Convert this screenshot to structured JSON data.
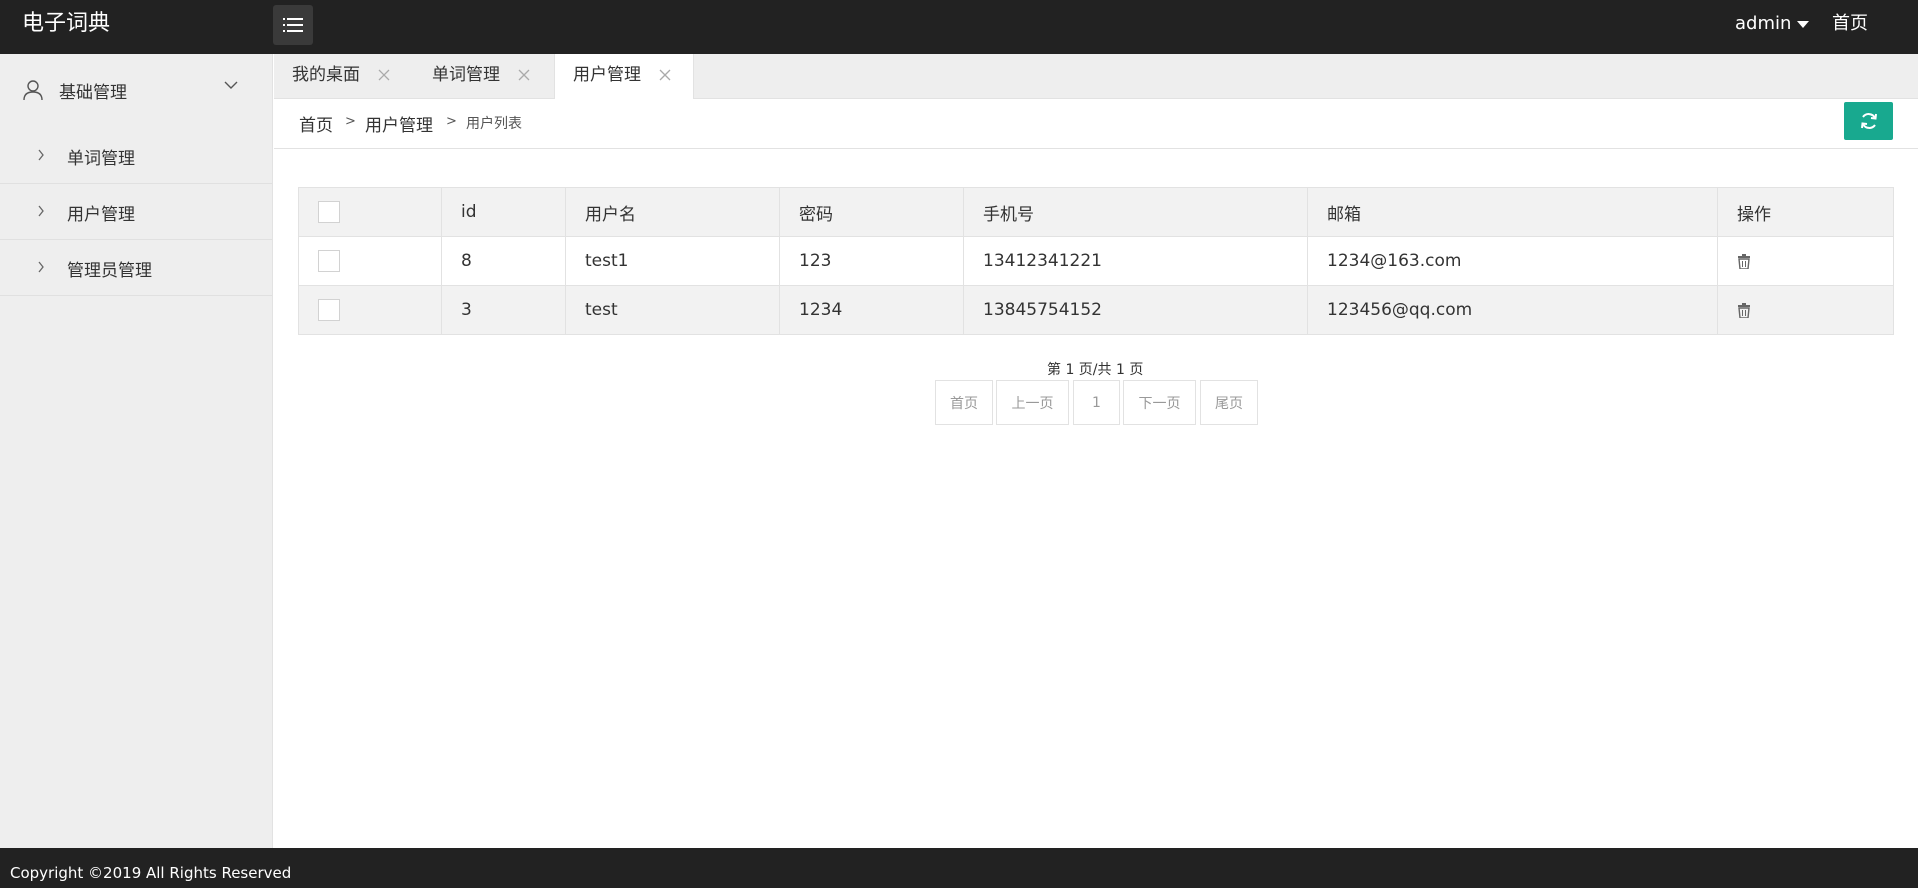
{
  "app": {
    "title": "电子词典"
  },
  "header": {
    "user": "admin",
    "home": "首页",
    "menu_icon": "menu-icon"
  },
  "sidebar": {
    "group": {
      "label": "基础管理",
      "icon": "user-icon"
    },
    "items": [
      {
        "label": "单词管理"
      },
      {
        "label": "用户管理"
      },
      {
        "label": "管理员管理"
      }
    ]
  },
  "tabs": [
    {
      "label": "我的桌面"
    },
    {
      "label": "单词管理"
    },
    {
      "label": "用户管理",
      "active": true
    }
  ],
  "breadcrumb": {
    "home": "首页",
    "sep": ">",
    "section": "用户管理",
    "current": "用户列表"
  },
  "table": {
    "columns": [
      "",
      "id",
      "用户名",
      "密码",
      "手机号",
      "邮箱",
      "操作"
    ],
    "rows": [
      {
        "id": "8",
        "username": "test1",
        "password": "123",
        "phone": "13412341221",
        "email": "1234@163.com"
      },
      {
        "id": "3",
        "username": "test",
        "password": "1234",
        "phone": "13845754152",
        "email": "123456@qq.com"
      }
    ]
  },
  "pagination": {
    "info": "第 1 页/共 1 页",
    "first": "首页",
    "prev": "上一页",
    "page": "1",
    "next": "下一页",
    "last": "尾页"
  },
  "footer": {
    "copyright": "Copyright ©2019 All Rights Reserved"
  },
  "colors": {
    "header_bg": "#222222",
    "accent": "#18a98f",
    "sidebar_bg": "#eeeeee"
  }
}
